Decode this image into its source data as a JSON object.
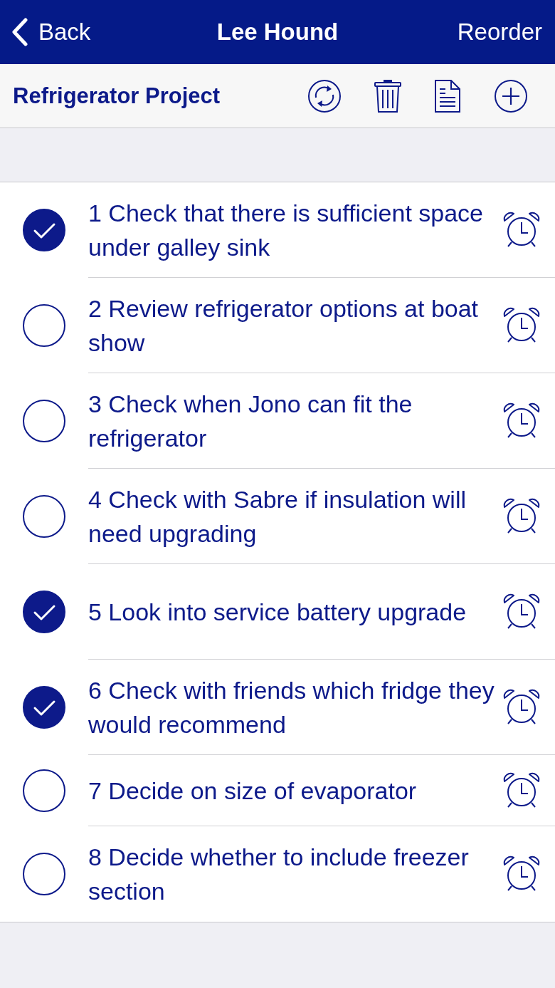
{
  "nav_bar": {
    "back": "Back",
    "title": "Lee Hound",
    "action": "Reorder"
  },
  "toolbar": {
    "title": "Refrigerator Project"
  },
  "tasks": [
    {
      "text": "1 Check that there is sufficient space under galley sink",
      "checked": true
    },
    {
      "text": "2 Review refrigerator options at boat show",
      "checked": false
    },
    {
      "text": "3 Check when Jono can fit the refrigerator",
      "checked": false
    },
    {
      "text": "4 Check with Sabre if insulation will need upgrading",
      "checked": false
    },
    {
      "text": "5 Look into service battery upgrade",
      "checked": true
    },
    {
      "text": "6 Check with friends which fridge they would recommend",
      "checked": true
    },
    {
      "text": "7 Decide on size of evaporator",
      "checked": false
    },
    {
      "text": "8 Decide whether to include freezer section",
      "checked": false
    }
  ]
}
